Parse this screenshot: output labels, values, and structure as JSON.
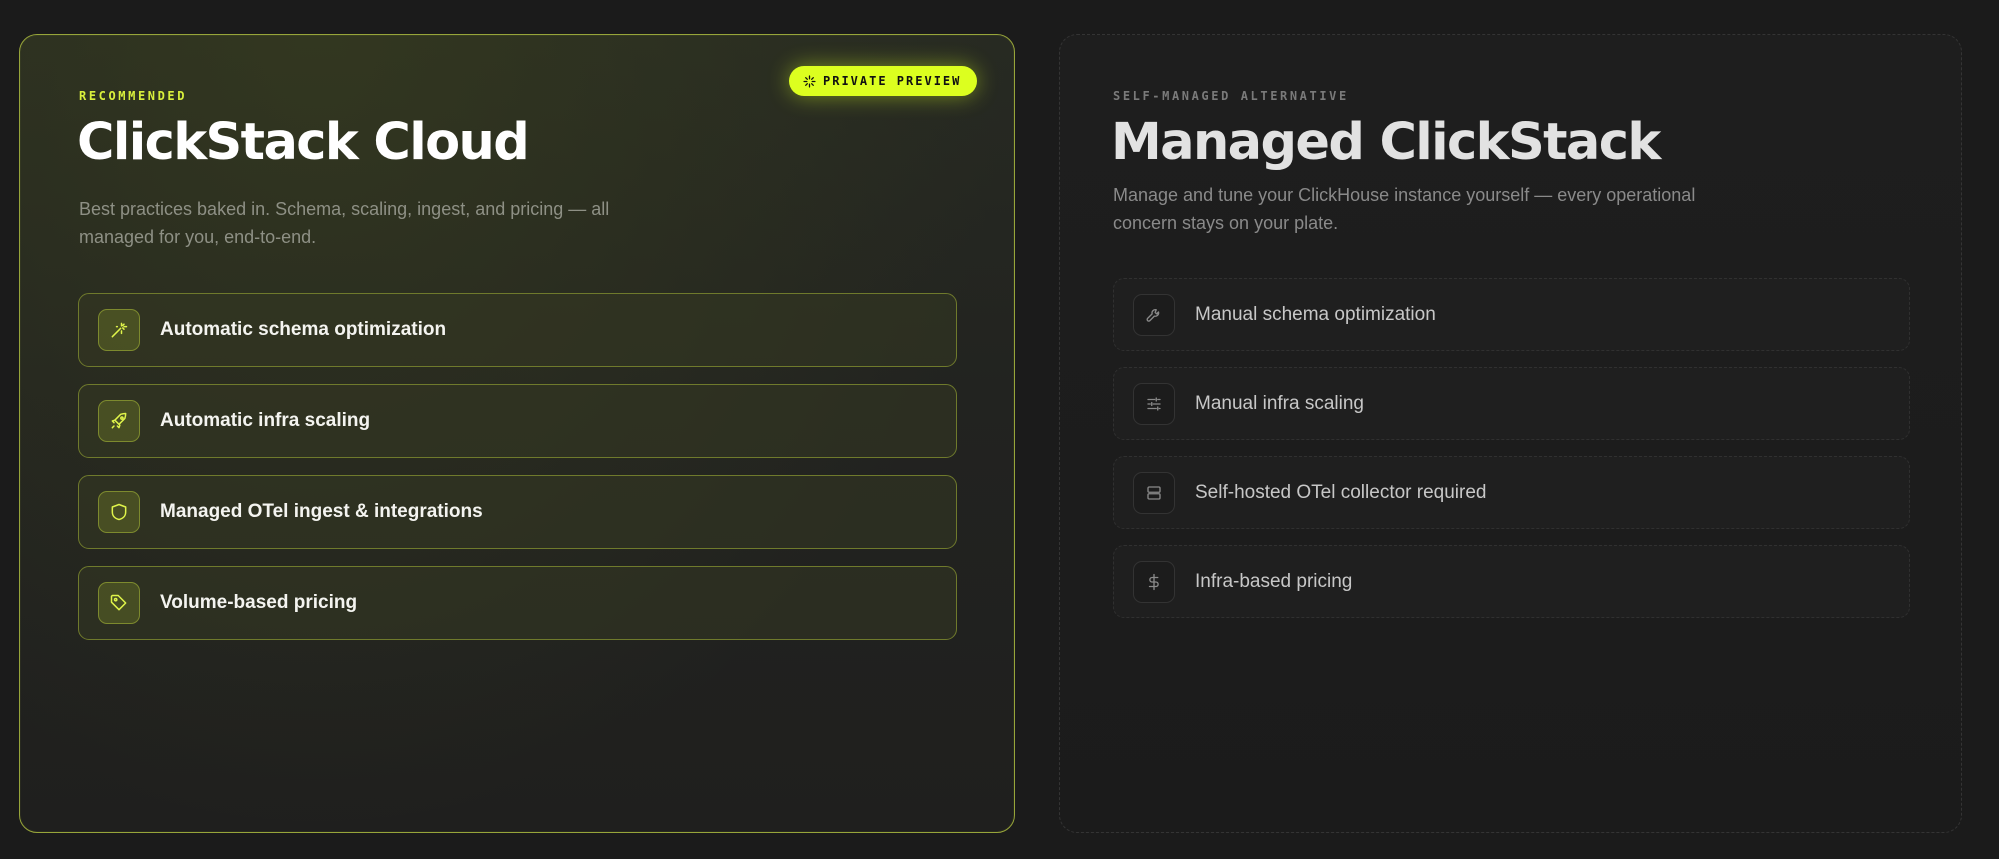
{
  "cloud": {
    "eyebrow": "RECOMMENDED",
    "badge": "PRIVATE PREVIEW",
    "badge_icon": "sparkles-icon",
    "title": "ClickStack Cloud",
    "subtitle": "Best practices baked in. Schema, scaling, ingest, and pricing — all managed for you, end-to-end.",
    "accent_color": "#dcff1f",
    "features": [
      {
        "label": "Automatic schema optimization",
        "icon": "magic-wand-icon"
      },
      {
        "label": "Automatic infra scaling",
        "icon": "rocket-icon"
      },
      {
        "label": "Managed OTel ingest & integrations",
        "icon": "shield-icon"
      },
      {
        "label": "Volume-based pricing",
        "icon": "tag-icon"
      }
    ]
  },
  "managed": {
    "eyebrow": "SELF-MANAGED ALTERNATIVE",
    "title": "Managed ClickStack",
    "subtitle": "Manage and tune your ClickHouse instance yourself — every operational concern stays on your plate.",
    "features": [
      {
        "label": "Manual schema optimization",
        "icon": "wrench-icon"
      },
      {
        "label": "Manual infra scaling",
        "icon": "sliders-icon"
      },
      {
        "label": "Self-hosted OTel collector required",
        "icon": "server-icon"
      },
      {
        "label": "Infra-based pricing",
        "icon": "dollar-icon"
      }
    ]
  }
}
